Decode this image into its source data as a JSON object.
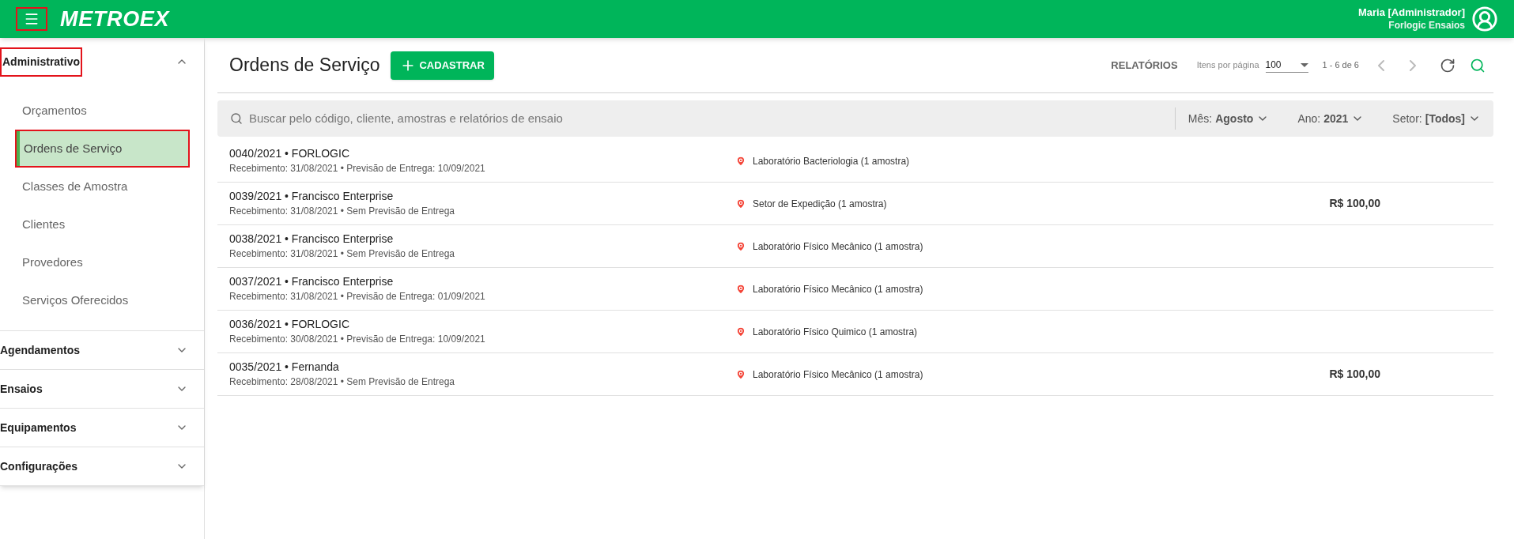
{
  "header": {
    "logo": "METROEX",
    "menu_highlighted": true,
    "user_name": "Maria [Administrador]",
    "company": "Forlogic Ensaios"
  },
  "sidebar": {
    "sections": [
      {
        "label": "Administrativo",
        "expanded": true,
        "highlighted": true,
        "items": [
          {
            "label": "Orçamentos",
            "selected": false,
            "highlighted": false
          },
          {
            "label": "Ordens de Serviço",
            "selected": true,
            "highlighted": true
          },
          {
            "label": "Classes de Amostra",
            "selected": false,
            "highlighted": false
          },
          {
            "label": "Clientes",
            "selected": false,
            "highlighted": false
          },
          {
            "label": "Provedores",
            "selected": false,
            "highlighted": false
          },
          {
            "label": "Serviços Oferecidos",
            "selected": false,
            "highlighted": false
          }
        ]
      },
      {
        "label": "Agendamentos",
        "expanded": false,
        "highlighted": false
      },
      {
        "label": "Ensaios",
        "expanded": false,
        "highlighted": false
      },
      {
        "label": "Equipamentos",
        "expanded": false,
        "highlighted": false
      },
      {
        "label": "Configurações",
        "expanded": false,
        "highlighted": false
      }
    ]
  },
  "page": {
    "title": "Ordens de Serviço",
    "add_button": "CADASTRAR",
    "reports_button": "RELATÓRIOS",
    "per_page_label": "Itens por página",
    "per_page_value": "100",
    "range": "1 - 6 de 6"
  },
  "filters": {
    "search_placeholder": "Buscar pelo código, cliente, amostras e relatórios de ensaio",
    "month_label": "Mês:",
    "month_value": "Agosto",
    "year_label": "Ano:",
    "year_value": "2021",
    "sector_label": "Setor:",
    "sector_value": "[Todos]"
  },
  "orders": [
    {
      "code": "0040/2021",
      "client": "• FORLOGIC",
      "dates": "Recebimento: 31/08/2021 • Previsão de Entrega: 10/09/2021",
      "location": "Laboratório Bacteriologia (1 amostra)"
    },
    {
      "code": "0039/2021",
      "client": "• Francisco Enterprise",
      "dates": "Recebimento: 31/08/2021 • Sem Previsão de Entrega",
      "location": "Setor de Expedição (1 amostra)",
      "price": "R$ 100,00"
    },
    {
      "code": "0038/2021",
      "client": "• Francisco Enterprise",
      "dates": "Recebimento: 31/08/2021 • Sem Previsão de Entrega",
      "location": "Laboratório Físico Mecânico (1 amostra)"
    },
    {
      "code": "0037/2021",
      "client": "• Francisco Enterprise",
      "dates": "Recebimento: 31/08/2021 • Previsão de Entrega: 01/09/2021",
      "location": "Laboratório Físico Mecânico (1 amostra)"
    },
    {
      "code": "0036/2021",
      "client": "• FORLOGIC",
      "dates": "Recebimento: 30/08/2021 • Previsão de Entrega: 10/09/2021",
      "location": "Laboratório Físico Quimico (1 amostra)"
    },
    {
      "code": "0035/2021",
      "client": "• Fernanda",
      "dates": "Recebimento: 28/08/2021 • Sem Previsão de Entrega",
      "location": "Laboratório Físico Mecânico (1 amostra)",
      "price": "R$ 100,00"
    }
  ]
}
